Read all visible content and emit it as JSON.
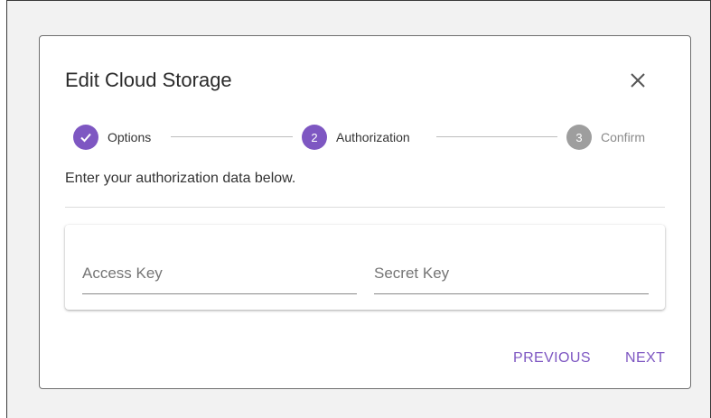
{
  "dialog": {
    "title": "Edit Cloud Storage",
    "instructions": "Enter your authorization data below."
  },
  "stepper": {
    "steps": [
      {
        "label": "Options",
        "state": "completed",
        "number": "1"
      },
      {
        "label": "Authorization",
        "state": "active",
        "number": "2"
      },
      {
        "label": "Confirm",
        "state": "pending",
        "number": "3"
      }
    ]
  },
  "form": {
    "access_key": {
      "placeholder": "Access Key",
      "value": ""
    },
    "secret_key": {
      "placeholder": "Secret Key",
      "value": ""
    }
  },
  "actions": {
    "previous_label": "PREVIOUS",
    "next_label": "NEXT"
  },
  "colors": {
    "accent": "#7e57c2",
    "pending": "#9e9e9e",
    "text": "#333333"
  },
  "icons": {
    "close": "close-icon",
    "completed_step": "check-icon"
  }
}
